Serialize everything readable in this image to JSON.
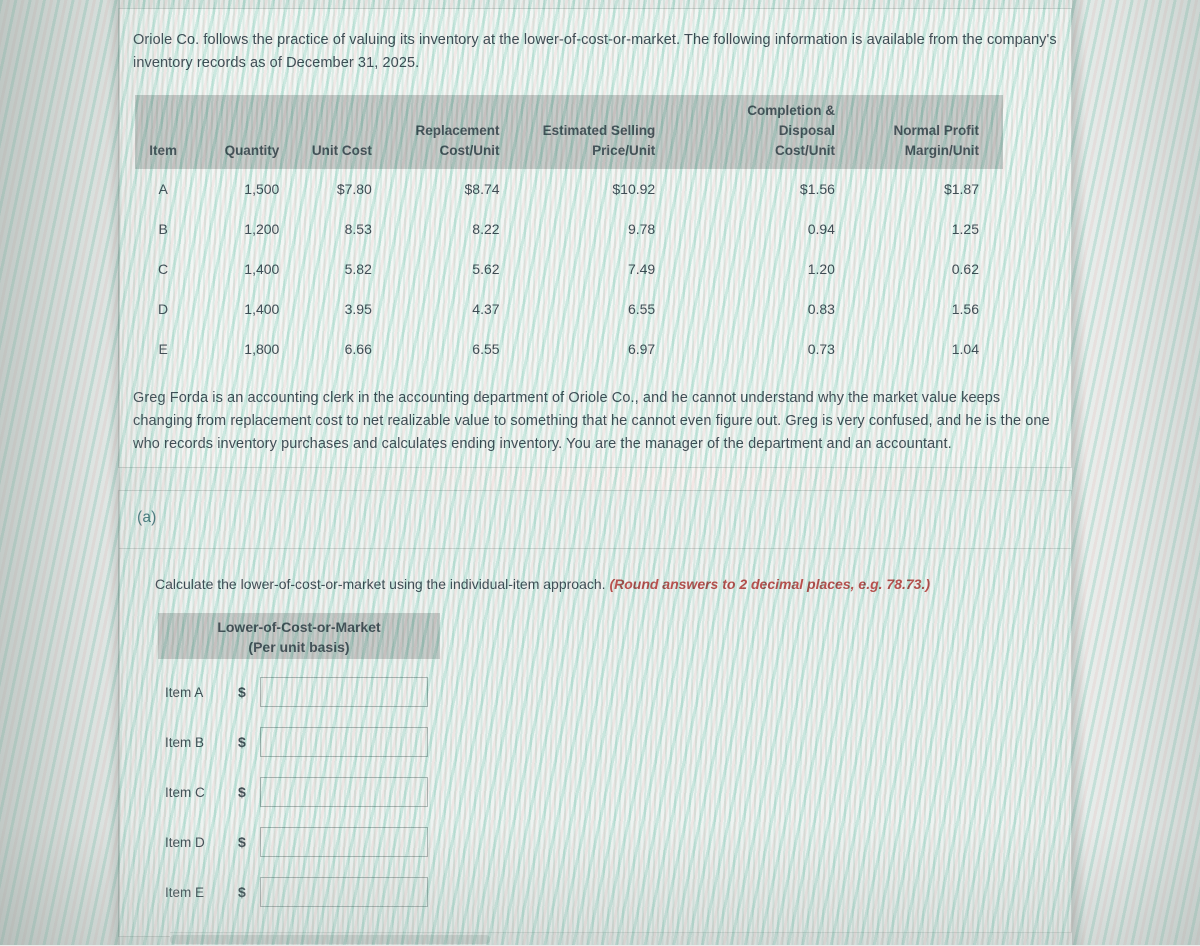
{
  "problem": {
    "intro": "Oriole Co. follows the practice of valuing its inventory at the lower-of-cost-or-market. The following information is available from the company's inventory records as of December 31, 2025.",
    "narrative": "Greg Forda is an accounting clerk in the accounting department of Oriole Co., and he cannot understand why the market value keeps changing from replacement cost to net realizable value to something that he cannot even figure out. Greg is very confused, and he is the one who records inventory purchases and calculates ending inventory. You are the manager of the department and an accountant."
  },
  "inventory_table": {
    "columns": [
      {
        "line1": "",
        "line2": "Item"
      },
      {
        "line1": "",
        "line2": "Quantity"
      },
      {
        "line1": "",
        "line2": "Unit Cost"
      },
      {
        "line1": "Replacement",
        "line2": "Cost/Unit"
      },
      {
        "line1": "Estimated Selling",
        "line2": "Price/Unit"
      },
      {
        "line1": "Completion & Disposal",
        "line2": "Cost/Unit"
      },
      {
        "line1": "Normal Profit",
        "line2": "Margin/Unit"
      }
    ],
    "rows": [
      {
        "item": "A",
        "quantity": "1,500",
        "unit_cost": "$7.80",
        "replacement_cost": "$8.74",
        "selling_price": "$10.92",
        "completion_disposal": "$1.56",
        "normal_profit": "$1.87"
      },
      {
        "item": "B",
        "quantity": "1,200",
        "unit_cost": "8.53",
        "replacement_cost": "8.22",
        "selling_price": "9.78",
        "completion_disposal": "0.94",
        "normal_profit": "1.25"
      },
      {
        "item": "C",
        "quantity": "1,400",
        "unit_cost": "5.82",
        "replacement_cost": "5.62",
        "selling_price": "7.49",
        "completion_disposal": "1.20",
        "normal_profit": "0.62"
      },
      {
        "item": "D",
        "quantity": "1,400",
        "unit_cost": "3.95",
        "replacement_cost": "4.37",
        "selling_price": "6.55",
        "completion_disposal": "0.83",
        "normal_profit": "1.56"
      },
      {
        "item": "E",
        "quantity": "1,800",
        "unit_cost": "6.66",
        "replacement_cost": "6.55",
        "selling_price": "6.97",
        "completion_disposal": "0.73",
        "normal_profit": "1.04"
      }
    ]
  },
  "part_a": {
    "label": "(a)",
    "instruction_main": "Calculate the lower-of-cost-or-market using the individual-item approach. ",
    "instruction_note": "(Round answers to 2 decimal places, e.g. 78.73.)",
    "answer_header_line1": "Lower-of-Cost-or-Market",
    "answer_header_line2": "(Per unit basis)",
    "currency_symbol": "$",
    "answer_rows": [
      {
        "label": "Item A",
        "value": "",
        "placeholder": ""
      },
      {
        "label": "Item B",
        "value": "",
        "placeholder": ""
      },
      {
        "label": "Item C",
        "value": "",
        "placeholder": ""
      },
      {
        "label": "Item D",
        "value": "",
        "placeholder": ""
      },
      {
        "label": "Item E",
        "value": "",
        "placeholder": ""
      }
    ]
  },
  "colors": {
    "table_header_band": "#c6cbc9",
    "card_background": "#f2f6f4",
    "card_border": "#c9d2cf",
    "text": "#41505a",
    "part_label": "#4a7f85",
    "round_note": "#c0504d",
    "input_border": "#a9b6b4"
  }
}
